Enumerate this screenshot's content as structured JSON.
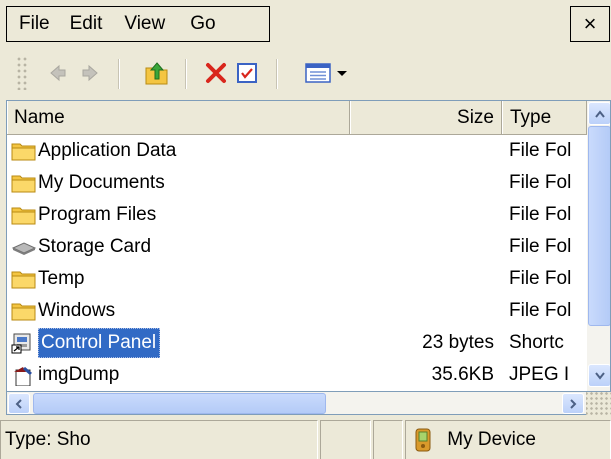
{
  "menu": {
    "items": [
      "File",
      "Edit",
      "View",
      "Go"
    ],
    "close_label": "×"
  },
  "toolbar": {
    "buttons": [
      "back-arrow-icon",
      "forward-arrow-icon",
      "up-folder-icon",
      "delete-icon",
      "properties-icon",
      "view-menu-icon"
    ]
  },
  "list": {
    "columns": {
      "name": "Name",
      "size": "Size",
      "type": "Type"
    },
    "rows": [
      {
        "name": "Application Data",
        "size": "",
        "type": "File Fol",
        "icon": "folder-icon"
      },
      {
        "name": "My Documents",
        "size": "",
        "type": "File Fol",
        "icon": "folder-icon"
      },
      {
        "name": "Program Files",
        "size": "",
        "type": "File Fol",
        "icon": "folder-icon"
      },
      {
        "name": "Storage Card",
        "size": "",
        "type": "File Fol",
        "icon": "storage-card-icon"
      },
      {
        "name": "Temp",
        "size": "",
        "type": "File Fol",
        "icon": "folder-icon"
      },
      {
        "name": "Windows",
        "size": "",
        "type": "File Fol",
        "icon": "folder-icon"
      },
      {
        "name": "Control Panel",
        "size": "23 bytes",
        "type": "Shortc",
        "icon": "shortcut-icon",
        "selected": true
      },
      {
        "name": "imgDump",
        "size": "35.6KB",
        "type": "JPEG I",
        "icon": "image-file-icon"
      }
    ]
  },
  "status": {
    "type_text": "Type: Sho",
    "device": "My Device"
  },
  "colors": {
    "selection": "#316ac5",
    "folder": "#f4c542",
    "delete_red": "#d9261c",
    "chrome": "#ece9d8"
  }
}
